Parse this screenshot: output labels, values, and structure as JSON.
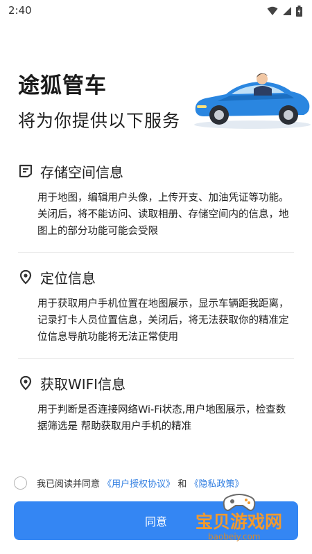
{
  "status_bar": {
    "time": "2:40"
  },
  "header": {
    "title": "途狐管车",
    "subtitle": "将为你提供以下服务"
  },
  "sections": [
    {
      "icon": "document-icon",
      "title": "存储空间信息",
      "body": "用于地图，编辑用户头像，上传开支、加油凭证等功能。关闭后，将不能访问、读取相册、存储空间内的信息，地图上的部分功能可能会受限"
    },
    {
      "icon": "location-pin-icon",
      "title": "定位信息",
      "body": "用于获取用户手机位置在地图展示，显示车辆距我距离，记录打卡人员位置信息，关闭后，将无法获取你的精准定位信息导航功能将无法正常使用"
    },
    {
      "icon": "location-pin-icon",
      "title": "获取WIFI信息",
      "body": "用于判断是否连接网络Wi-Fi状态,用户地图展示，检查数据筛选是 帮助获取用户手机的精准"
    }
  ],
  "agreement": {
    "prefix": "我已阅读并同意",
    "link_terms": "《用户授权协议》",
    "and": "和",
    "link_privacy": "《隐私政策》"
  },
  "button": {
    "agree_label": "同意"
  },
  "watermark": {
    "text": "宝贝游戏网",
    "url": "baobeiy.com"
  },
  "colors": {
    "accent": "#3486f3",
    "link": "#2f7de1",
    "watermark": "#f29a2e"
  }
}
